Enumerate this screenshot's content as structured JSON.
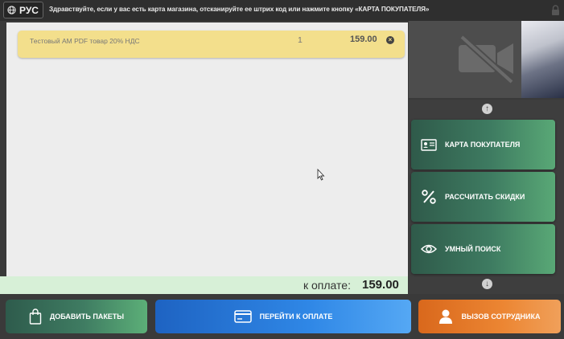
{
  "topbar": {
    "language": "РУС",
    "greeting": "Здравствуйте, если у вас есть карта магазина, отсканируйте ее штрих код или нажмите кнопку «КАРТА ПОКУПАТЕЛЯ»"
  },
  "cart": {
    "items": [
      {
        "name": "Тестовый АМ PDF товар 20% НДС",
        "qty": "1",
        "price": "159.00"
      }
    ]
  },
  "total": {
    "label": "к оплате:",
    "value": "159.00"
  },
  "sidebar": {
    "buttons": [
      {
        "label": "КАРТА ПОКУПАТЕЛЯ",
        "icon": "id-card-icon"
      },
      {
        "label": "РАССЧИТАТЬ СКИДКИ",
        "icon": "percent-icon"
      },
      {
        "label": "УМНЫЙ ПОИСК",
        "icon": "eye-icon"
      }
    ]
  },
  "bottom": {
    "bags_label": "ДОБАВИТЬ ПАКЕТЫ",
    "pay_label": "ПЕРЕЙТИ К ОПЛАТЕ",
    "staff_label": "ВЫЗОВ СОТРУДНИКА"
  },
  "colors": {
    "accent_green": "#3e7b61",
    "accent_blue": "#2f87e6",
    "accent_orange": "#ec8633",
    "item_highlight": "#f3df8c",
    "total_bg": "#d7f0d7"
  }
}
